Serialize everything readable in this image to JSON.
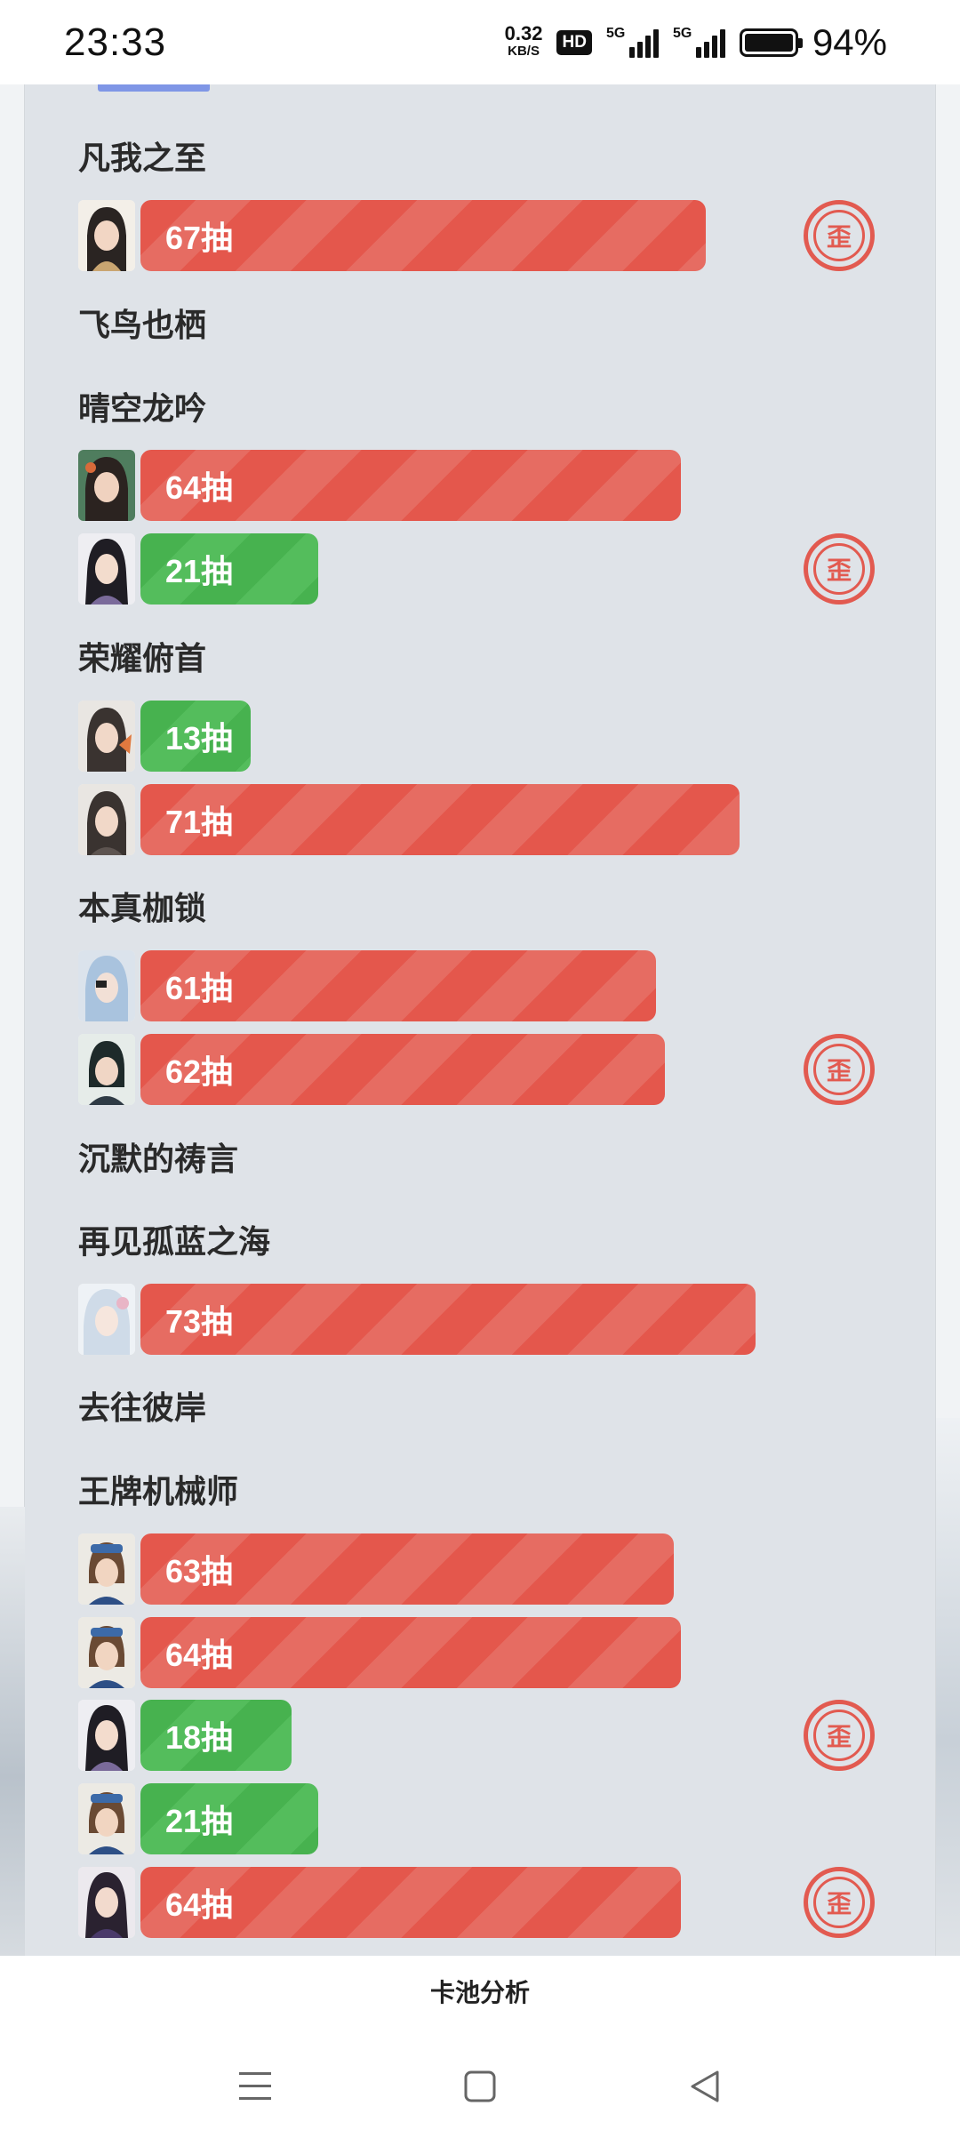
{
  "status_bar": {
    "time": "23:33",
    "net_speed_value": "0.32",
    "net_speed_unit": "KB/S",
    "hd_label": "HD",
    "sim1_label": "5G",
    "sim2_label": "5G",
    "battery_percent": "94%"
  },
  "colors": {
    "loss_bar": "#e4574c",
    "win_bar": "#47b24f",
    "waii_stamp": "#e25a50",
    "tab_indicator": "#7f96e6"
  },
  "pools": [
    {
      "title": "凡我之至"
    },
    {
      "title": "飞鸟也栖"
    },
    {
      "title": "晴空龙吟"
    },
    {
      "title": "荣耀俯首"
    },
    {
      "title": "本真枷锁"
    },
    {
      "title": "沉默的祷言"
    },
    {
      "title": "再见孤蓝之海"
    },
    {
      "title": "去往彼岸"
    },
    {
      "title": "王牌机械师"
    }
  ],
  "pulls": [
    {
      "label": "67抽",
      "count": 67,
      "color": "red"
    },
    {
      "label": "64抽",
      "count": 64,
      "color": "red"
    },
    {
      "label": "21抽",
      "count": 21,
      "color": "green"
    },
    {
      "label": "13抽",
      "count": 13,
      "color": "green"
    },
    {
      "label": "71抽",
      "count": 71,
      "color": "red"
    },
    {
      "label": "61抽",
      "count": 61,
      "color": "red"
    },
    {
      "label": "62抽",
      "count": 62,
      "color": "red"
    },
    {
      "label": "73抽",
      "count": 73,
      "color": "red"
    },
    {
      "label": "63抽",
      "count": 63,
      "color": "red"
    },
    {
      "label": "64抽",
      "count": 64,
      "color": "red"
    },
    {
      "label": "18抽",
      "count": 18,
      "color": "green"
    },
    {
      "label": "21抽",
      "count": 21,
      "color": "green"
    },
    {
      "label": "64抽",
      "count": 64,
      "color": "red"
    }
  ],
  "waii_label": "歪",
  "bottom_tab_label": "卡池分析",
  "nav": {
    "menu_icon": "menu-icon",
    "home_icon": "home-square-icon",
    "back_icon": "back-triangle-icon"
  }
}
